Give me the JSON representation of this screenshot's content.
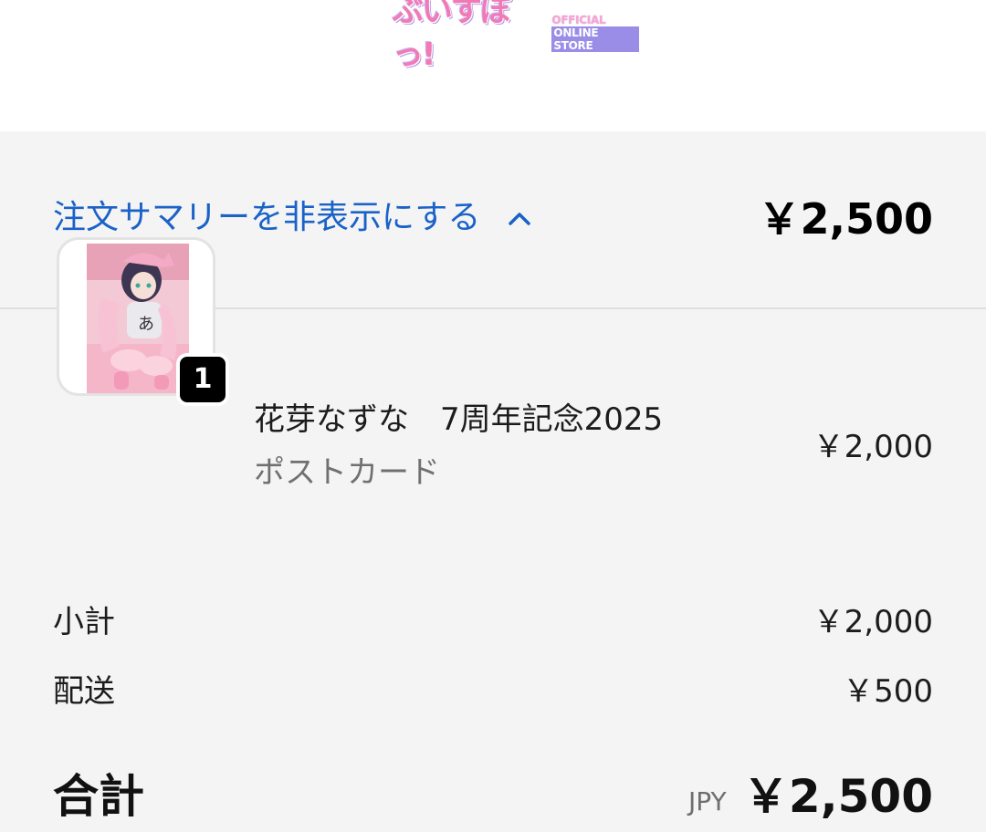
{
  "header": {
    "logo_main": "ぶいすぽっ!",
    "logo_sub_line1": "OFFICIAL",
    "logo_sub_line2": "ONLINE STORE"
  },
  "summary": {
    "toggle_label": "注文サマリーを非表示にする",
    "toggle_total": "￥2,500"
  },
  "item": {
    "quantity": "1",
    "name": "花芽なずな　7周年記念2025",
    "variant": "ポストカード",
    "price": "￥2,000"
  },
  "lines": {
    "subtotal_label": "小計",
    "subtotal_value": "￥2,000",
    "shipping_label": "配送",
    "shipping_value": "￥500"
  },
  "total": {
    "label": "合計",
    "currency": "JPY",
    "value": "￥2,500"
  },
  "colors": {
    "link": "#1a62c7",
    "panel_bg": "#f4f4f4",
    "badge_bg": "#000000"
  }
}
